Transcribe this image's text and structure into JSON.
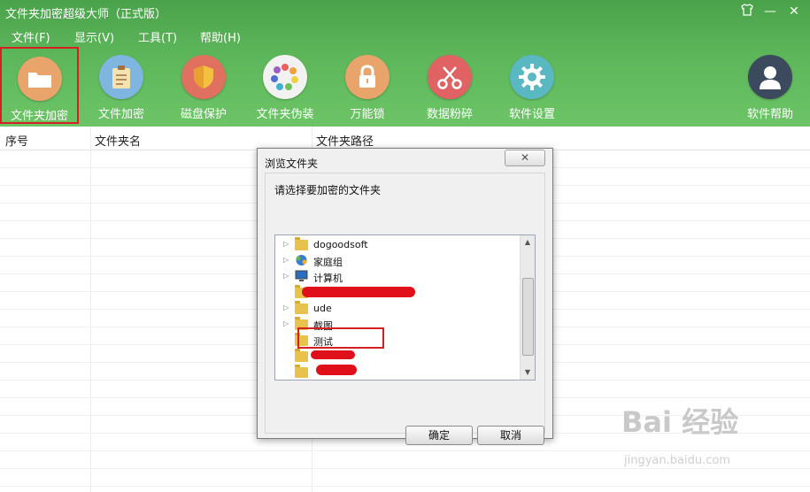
{
  "app": {
    "title": "文件夹加密超级大师（正式版）",
    "window_controls": [
      "shirt-icon",
      "minimize-icon",
      "close-icon"
    ]
  },
  "menu": {
    "items": [
      {
        "label": "文件(F)"
      },
      {
        "label": "显示(V)"
      },
      {
        "label": "工具(T)"
      },
      {
        "label": "帮助(H)"
      }
    ]
  },
  "toolbar": {
    "items": [
      {
        "label": "文件夹加密",
        "icon": "folder-icon",
        "color": "#e8a46a",
        "selected": true
      },
      {
        "label": "文件加密",
        "icon": "clipboard-icon",
        "color": "#7fb6e0"
      },
      {
        "label": "磁盘保护",
        "icon": "shield-icon",
        "color": "#e07060"
      },
      {
        "label": "文件夹伪装",
        "icon": "color-wheel-icon",
        "color": "#f2f2f2"
      },
      {
        "label": "万能锁",
        "icon": "lock-icon",
        "color": "#e8a46a"
      },
      {
        "label": "数据粉碎",
        "icon": "scissors-icon",
        "color": "#e06262"
      },
      {
        "label": "软件设置",
        "icon": "gear-icon",
        "color": "#5ab8c2"
      }
    ],
    "help": {
      "label": "软件帮助",
      "icon": "user-icon",
      "color": "#3c4a5e"
    }
  },
  "table": {
    "columns": [
      "序号",
      "文件夹名",
      "文件夹路径"
    ]
  },
  "dialog": {
    "title": "浏览文件夹",
    "close_label": "✕",
    "prompt": "请选择要加密的文件夹",
    "tree": [
      {
        "label": "dogoodsoft",
        "icon": "user-folder-icon",
        "expandable": true
      },
      {
        "label": "家庭组",
        "icon": "homegroup-icon",
        "expandable": true
      },
      {
        "label": "计算机",
        "icon": "computer-icon",
        "expandable": true
      },
      {
        "label": "",
        "icon": "folder-icon",
        "expandable": false,
        "redacted": true
      },
      {
        "label": "ude",
        "icon": "folder-icon",
        "expandable": true
      },
      {
        "label": "截图",
        "icon": "folder-icon",
        "expandable": true
      },
      {
        "label": "测试",
        "icon": "folder-icon",
        "expandable": false,
        "highlighted": true
      },
      {
        "label": "",
        "icon": "folder-icon",
        "expandable": false,
        "redacted": true
      },
      {
        "label": "",
        "icon": "folder-icon",
        "expandable": false,
        "redacted": true
      }
    ],
    "ok_label": "确定",
    "cancel_label": "取消"
  },
  "watermark": {
    "brand": "Bai 经验",
    "url": "jingyan.baidu.com"
  }
}
